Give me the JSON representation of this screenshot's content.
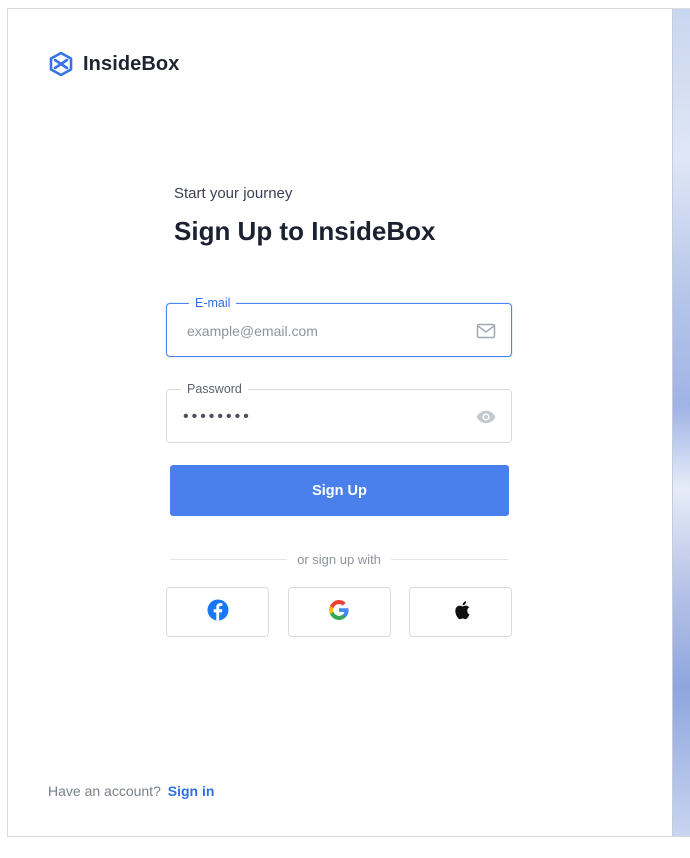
{
  "brand": {
    "name": "InsideBox",
    "icon": "cube-logo-icon",
    "color": "#3a73e8"
  },
  "header": {
    "subtitle": "Start your journey",
    "title": "Sign Up to InsideBox"
  },
  "form": {
    "email": {
      "label": "E-mail",
      "placeholder": "example@email.com",
      "value": "",
      "icon": "mail-icon"
    },
    "password": {
      "label": "Password",
      "value": "••••••••",
      "icon": "eye-icon"
    },
    "submit_label": "Sign Up"
  },
  "divider_text": "or sign up with",
  "socials": [
    {
      "name": "Facebook",
      "icon": "facebook-icon"
    },
    {
      "name": "Google",
      "icon": "google-icon"
    },
    {
      "name": "Apple",
      "icon": "apple-icon"
    }
  ],
  "footer": {
    "prompt": "Have an account?",
    "link": "Sign in"
  },
  "colors": {
    "primary": "#4a80ec",
    "link": "#2f6fe4",
    "text": "#1f2430"
  }
}
